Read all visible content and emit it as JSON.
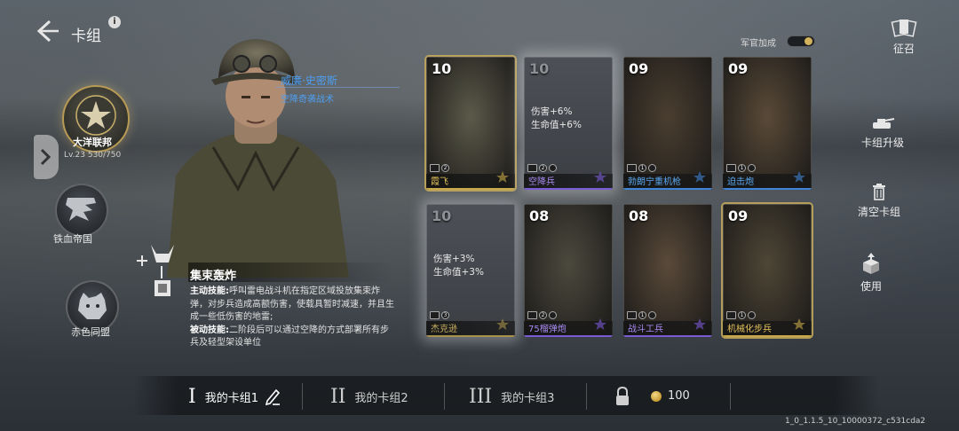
{
  "header": {
    "title": "卡组",
    "info": "i"
  },
  "factions": [
    {
      "name": "大洋联邦",
      "level": "Lv.23",
      "progress": "530/750",
      "selected": true
    },
    {
      "name": "铁血帝国",
      "selected": false
    },
    {
      "name": "赤色同盟",
      "selected": false
    }
  ],
  "commander": {
    "name": "威廉·史密斯",
    "tactic": "空降奇袭战术",
    "skill": {
      "name": "集束轰炸",
      "active_label": "主动技能:",
      "active_text": "呼叫雷电战斗机在指定区域投放集束炸弹，对步兵造成高额伤害，使载具暂时减速，并且生成一些低伤害的地雷;",
      "passive_label": "被动技能:",
      "passive_text": "二阶段后可以通过空降的方式部署所有步兵及轻型架设单位"
    }
  },
  "officer_bonus": {
    "label": "军官加成",
    "enabled": true
  },
  "cards": [
    {
      "cost": "10",
      "name": "霞飞",
      "style": "gold",
      "dim": false,
      "stats": [],
      "tags": [
        "tank",
        "2"
      ],
      "name_color": "#e4c25a",
      "line_color": "#c9a949"
    },
    {
      "cost": "10",
      "name": "空降兵",
      "style": "purple",
      "dim": true,
      "stats": [
        "伤害+6%",
        "生命值+6%"
      ],
      "tags": [
        "para",
        "2",
        "flag"
      ],
      "name_color": "#a78bf0",
      "line_color": "#7a5bd6"
    },
    {
      "cost": "09",
      "name": "勃朗宁重机枪",
      "style": "blue",
      "dim": false,
      "stats": [],
      "tags": [
        "mg",
        "1",
        "flag"
      ],
      "name_color": "#5aa8f0",
      "line_color": "#3f84d6"
    },
    {
      "cost": "09",
      "name": "迫击炮",
      "style": "blue",
      "dim": false,
      "stats": [],
      "tags": [
        "mortar",
        "1",
        "flag"
      ],
      "name_color": "#5aa8f0",
      "line_color": "#3f84d6"
    },
    {
      "cost": "10",
      "name": "杰克逊",
      "style": "gold",
      "dim": true,
      "stats": [
        "伤害+3%",
        "生命值+3%"
      ],
      "tags": [
        "tank",
        "3"
      ],
      "name_color": "#c9b060",
      "line_color": "#a8914a"
    },
    {
      "cost": "08",
      "name": "75榴弹炮",
      "style": "purple",
      "dim": false,
      "stats": [],
      "tags": [
        "gun",
        "2",
        "flag"
      ],
      "name_color": "#a78bf0",
      "line_color": "#7a5bd6"
    },
    {
      "cost": "08",
      "name": "战斗工兵",
      "style": "purple",
      "dim": false,
      "stats": [],
      "tags": [
        "eng",
        "1",
        "flag"
      ],
      "name_color": "#a78bf0",
      "line_color": "#7a5bd6"
    },
    {
      "cost": "09",
      "name": "机械化步兵",
      "style": "gold",
      "dim": false,
      "stats": [],
      "tags": [
        "mech",
        "1",
        "flag"
      ],
      "name_color": "#e4c25a",
      "line_color": "#c9a949"
    }
  ],
  "right_actions": {
    "recruit": "征召",
    "upgrade": "卡组升级",
    "clear": "清空卡组",
    "use": "使用"
  },
  "deck_tabs": [
    {
      "roman": "I",
      "label": "我的卡组1",
      "active": true
    },
    {
      "roman": "II",
      "label": "我的卡组2",
      "active": false
    },
    {
      "roman": "III",
      "label": "我的卡组3",
      "active": false
    }
  ],
  "currency": {
    "value": "100"
  },
  "version": "1_0_1.1.5_10_10000372_c531cda2"
}
